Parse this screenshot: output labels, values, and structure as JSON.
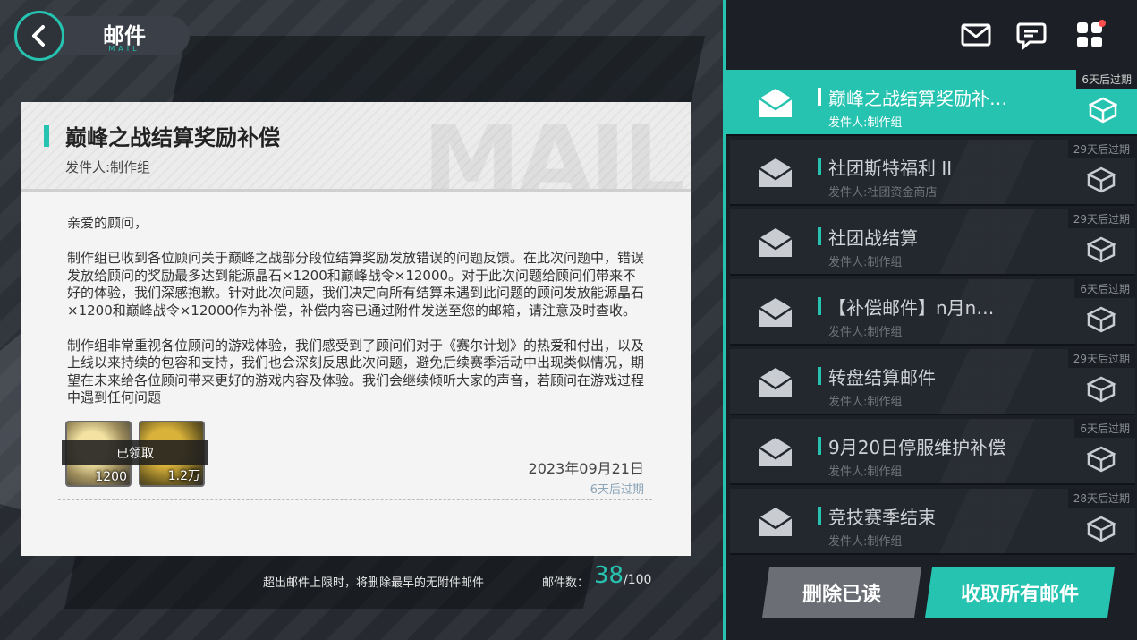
{
  "header": {
    "title": "邮件",
    "subtitle": "MAIL"
  },
  "card": {
    "watermark": "MAIL",
    "title": "巅峰之战结算奖励补偿",
    "sender": "发件人:制作组",
    "body": [
      "亲爱的顾问，",
      "制作组已收到各位顾问关于巅峰之战部分段位结算奖励发放错误的问题反馈。在此次问题中，错误发放给顾问的奖励最多达到能源晶石×1200和巅峰战令×12000。对于此次问题给顾问们带来不好的体验，我们深感抱歉。针对此次问题，我们决定向所有结算未遇到此问题的顾问发放能源晶石×1200和巅峰战令×12000作为补偿，补偿内容已通过附件发送至您的邮箱，请注意及时查收。",
      "制作组非常重视各位顾问的游戏体验，我们感受到了顾问们对于《赛尔计划》的热爱和付出，以及上线以来持续的包容和支持，我们也会深刻反思此次问题，避免后续赛季活动中出现类似情况，期望在未来给各位顾问带来更好的游戏内容及体验。我们会继续倾听大家的声音，若顾问在游戏过程中遇到任何问题"
    ],
    "attachments": [
      {
        "amount": "1200"
      },
      {
        "amount": "1.2万"
      }
    ],
    "claimed_label": "已领取",
    "date": "2023年09月21日",
    "expire": "6天后过期"
  },
  "footer": {
    "limit_note": "超出邮件上限时，将删除最早的无附件邮件",
    "count_label": "邮件数：",
    "count": "38",
    "count_max": "/100"
  },
  "mail_list": [
    {
      "title": "巅峰之战结算奖励补…",
      "sender": "发件人:制作组",
      "expire": "6天后过期"
    },
    {
      "title": "社团斯特福利 II",
      "sender": "发件人:社团资金商店",
      "expire": "29天后过期"
    },
    {
      "title": "社团战结算",
      "sender": "发件人:制作组",
      "expire": "29天后过期"
    },
    {
      "title": "【补偿邮件】n月n…",
      "sender": "发件人:制作组",
      "expire": "6天后过期"
    },
    {
      "title": "转盘结算邮件",
      "sender": "发件人:制作组",
      "expire": "29天后过期"
    },
    {
      "title": "9月20日停服维护补偿",
      "sender": "发件人:制作组",
      "expire": "6天后过期"
    },
    {
      "title": "竞技赛季结束",
      "sender": "发件人:制作组",
      "expire": "28天后过期"
    }
  ],
  "buttons": {
    "delete_read": "删除已读",
    "claim_all": "收取所有邮件"
  },
  "colors": {
    "accent": "#26c3b1",
    "panel": "#1c2026",
    "notify": "#ff4d4d"
  },
  "icons": [
    "back-arrow-icon",
    "mail-icon",
    "chat-icon",
    "menu-grid-icon",
    "envelope-icon",
    "gift-box-icon"
  ]
}
